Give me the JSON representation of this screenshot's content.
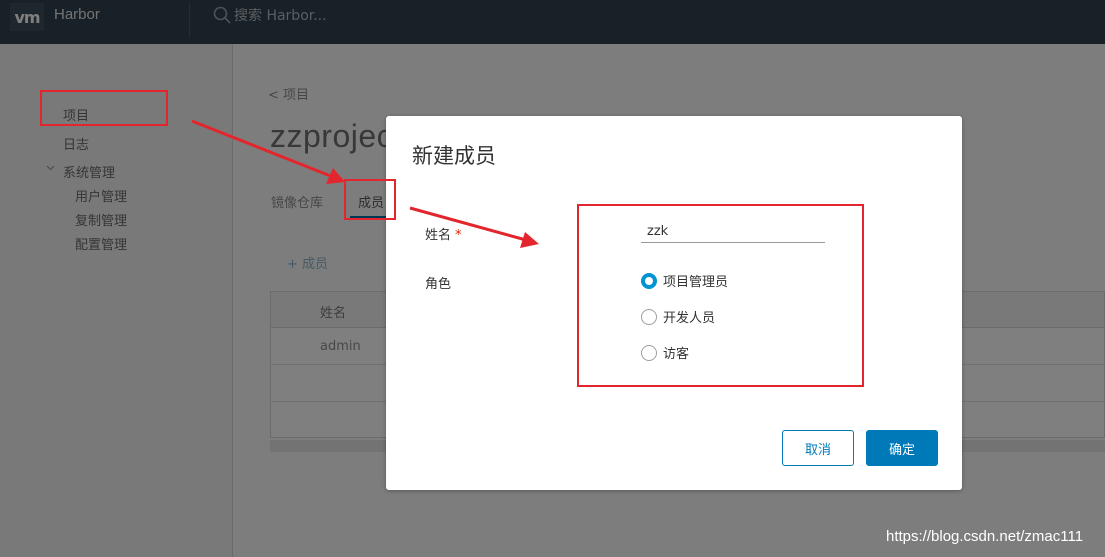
{
  "header": {
    "logo_text": "vm",
    "app_name": "Harbor",
    "search_placeholder": "搜索 Harbor..."
  },
  "sidebar": {
    "items": [
      {
        "label": "项目"
      },
      {
        "label": "日志"
      },
      {
        "label": "系统管理"
      },
      {
        "label": "用户管理"
      },
      {
        "label": "复制管理"
      },
      {
        "label": "配置管理"
      }
    ]
  },
  "main": {
    "breadcrumb": "< 项目",
    "project_title": "zzprojec",
    "tabs": [
      {
        "label": "镜像仓库"
      },
      {
        "label": "成员"
      }
    ],
    "add_member_label": "+ 成员",
    "table": {
      "header": "姓名",
      "rows": [
        "admin",
        "",
        ""
      ]
    }
  },
  "modal": {
    "title": "新建成员",
    "name_label": "姓名",
    "required_mark": "*",
    "role_label": "角色",
    "name_value": "zzk",
    "roles": [
      {
        "label": "项目管理员",
        "checked": true
      },
      {
        "label": "开发人员",
        "checked": false
      },
      {
        "label": "访客",
        "checked": false
      }
    ],
    "cancel_label": "取消",
    "ok_label": "确定"
  },
  "watermark": "https://blog.csdn.net/zmac111",
  "colors": {
    "header_bg": "#314351",
    "primary": "#0079b8",
    "radio_checked": "#0094d2",
    "annotation_red": "#e3262d"
  }
}
